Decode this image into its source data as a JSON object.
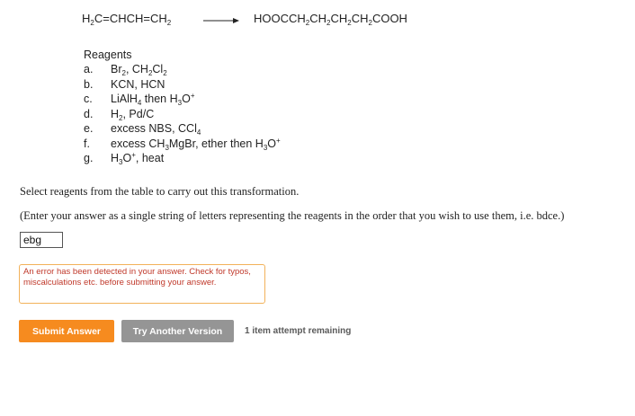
{
  "reaction": {
    "starting_material": "H2C=CHCH=CH2",
    "product": "HOOCCH2CH2CH2CH2COOH"
  },
  "reagents": {
    "heading": "Reagents",
    "items": [
      {
        "letter": "a.",
        "text": "Br2, CH2Cl2"
      },
      {
        "letter": "b.",
        "text": "KCN, HCN"
      },
      {
        "letter": "c.",
        "text": "LiAlH4 then H3O+"
      },
      {
        "letter": "d.",
        "text": "H2, Pd/C"
      },
      {
        "letter": "e.",
        "text": "excess NBS, CCl4"
      },
      {
        "letter": "f.",
        "text": "excess CH3MgBr, ether then H3O+"
      },
      {
        "letter": "g.",
        "text": "H3O+, heat"
      }
    ]
  },
  "question": {
    "line1": "Select reagents from the table to carry out this transformation.",
    "line2": "(Enter your answer as a single string of letters representing the reagents in the order that you wish to use them, i.e. bdce.)"
  },
  "answer": {
    "value": "ebg"
  },
  "error": {
    "message": "An error has been detected in your answer. Check for typos, miscalculations etc. before submitting your answer."
  },
  "buttons": {
    "submit_label": "Submit Answer",
    "try_another_label": "Try Another Version"
  },
  "attempts_text": "1 item attempt remaining",
  "colors": {
    "submit": "#f68b1f",
    "try_another": "#959595",
    "error_text": "#c0392b",
    "error_border": "#f2b25a"
  }
}
